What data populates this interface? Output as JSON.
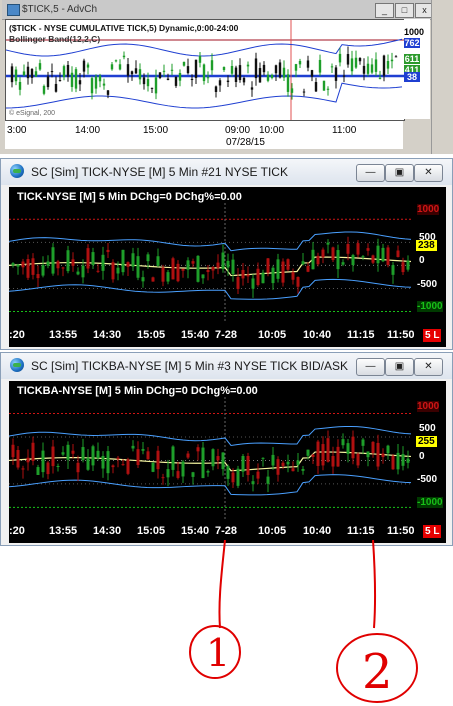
{
  "window1": {
    "title": "$TICK,5 - AdvCh",
    "study_line1": "($TICK - NYSE CUMULATIVE TICK,5) Dynamic,0:00-24:00",
    "study_line2": "Bollinger Band(12,2,C)",
    "watermark": "© eSignal, 200",
    "scale_top": "1000",
    "tags": [
      {
        "text": "762",
        "color": "#1f3fd1"
      },
      {
        "text": "611",
        "color": "#2c9a2c"
      },
      {
        "text": "411",
        "color": "#2c9a2c"
      },
      {
        "text": "38",
        "color": "#1f3fd1"
      }
    ],
    "time_labels": [
      "3:00",
      "14:00",
      "15:00",
      "09:00",
      "10:00",
      "11:00"
    ],
    "date_label": "07/28/15",
    "buttons": [
      "_",
      "□",
      "x"
    ]
  },
  "window2": {
    "title": "SC [Sim] TICK-NYSE [M] 5 Min  #21  NYSE TICK",
    "header": "TICK-NYSE [M] 5 Min  DChg=0 DChg%=0.00",
    "levels": [
      "1000",
      "500",
      "0",
      "-500",
      "-1000"
    ],
    "last_value": "238",
    "time_labels": [
      ":20",
      "13:55",
      "14:30",
      "15:05",
      "15:40",
      "7-28",
      "10:05",
      "10:40",
      "11:15",
      "11:50"
    ],
    "badge": "5 L",
    "buttons": [
      "—",
      "▣",
      "✕"
    ]
  },
  "window3": {
    "title": "SC [Sim] TICKBA-NYSE [M] 5 Min  #3  NYSE TICK BID/ASK",
    "header": "TICKBA-NYSE [M] 5 Min  DChg=0 DChg%=0.00",
    "levels": [
      "1000",
      "500",
      "0",
      "-500",
      "-1000"
    ],
    "last_value": "255",
    "time_labels": [
      ":20",
      "13:55",
      "14:30",
      "15:05",
      "15:40",
      "7-28",
      "10:05",
      "10:40",
      "11:15",
      "11:50"
    ],
    "badge": "5 L",
    "buttons": [
      "—",
      "▣",
      "✕"
    ]
  },
  "annotations": [
    "1",
    "2"
  ],
  "colors": {
    "up_candle": "#1e9e2a",
    "down_candle": "#b01010",
    "band": "#4aa0ff",
    "mid": "#f5f5a0",
    "level_red": "#d01515",
    "level_green": "#18c018",
    "ink": "#e00000"
  }
}
